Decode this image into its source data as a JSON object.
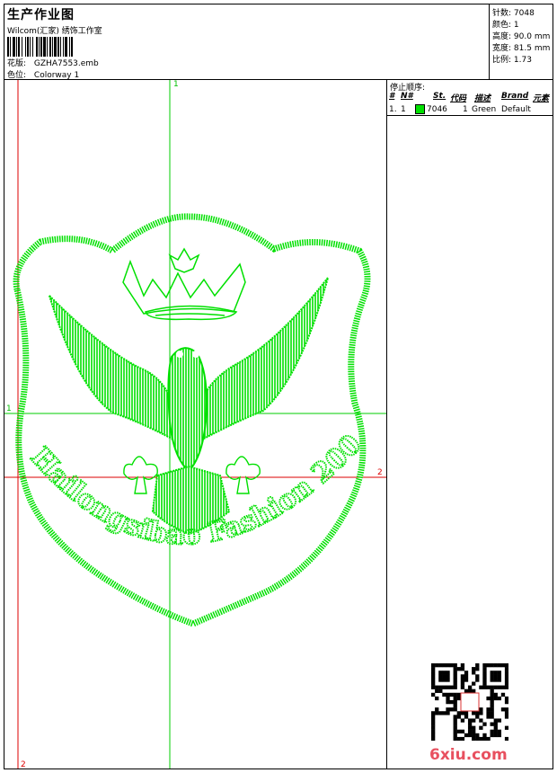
{
  "header": {
    "title": "生产作业图",
    "studio": "Wilcom(汇家) 绣饰工作室",
    "design_label": "花版:",
    "design_value": "GZHA7553.emb",
    "colorway_label": "色位:",
    "colorway_value": "Colorway 1"
  },
  "stats": [
    {
      "label": "针数:",
      "value": "7048"
    },
    {
      "label": "颜色:",
      "value": "1"
    },
    {
      "label": "高度:",
      "value": "90.0 mm"
    },
    {
      "label": "宽度:",
      "value": "81.5 mm"
    },
    {
      "label": "比例:",
      "value": "1.73"
    }
  ],
  "stop_sequence": {
    "title": "停止顺序:",
    "columns": [
      "#",
      "N#",
      "St.",
      "代码",
      "描述",
      "Brand",
      "元素"
    ],
    "rows": [
      {
        "index": "1.",
        "needle": "1",
        "stitches": "7046",
        "code": "1",
        "description": "Green",
        "brand": "Default",
        "swatch_color": "#00e000"
      }
    ]
  },
  "guides": {
    "vertical_top": "1",
    "vertical_bottom": "2",
    "horizontal_left": "1",
    "horizontal_right": "2"
  },
  "embroidery": {
    "text": "Hailongsibao Fashion 2008",
    "thread_color": "#00e000",
    "guide_green": "#00cc00",
    "guide_red": "#dd0000"
  },
  "watermark": "6xiu.com"
}
